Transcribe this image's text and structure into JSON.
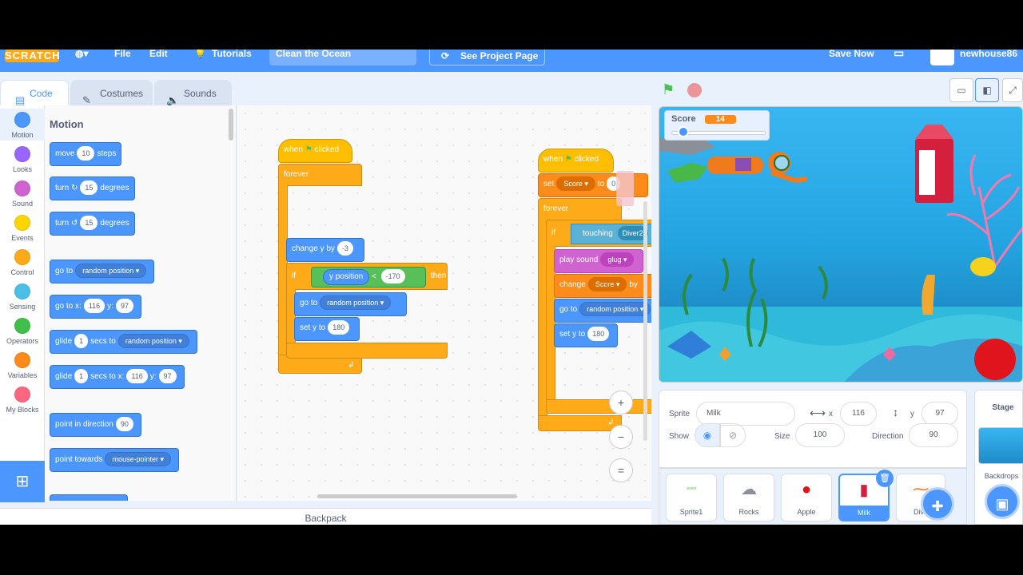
{
  "menubar": {
    "logo": "SCRATCH",
    "file": "File",
    "edit": "Edit",
    "tutorials": "Tutorials",
    "project_title": "Clean the Ocean",
    "see_project_page": "See Project Page",
    "save_now": "Save Now",
    "username": "newhouse86"
  },
  "tabs": [
    {
      "label": "Code",
      "icon": "code-icon"
    },
    {
      "label": "Costumes",
      "icon": "brush-icon"
    },
    {
      "label": "Sounds",
      "icon": "speaker-icon"
    }
  ],
  "categories": [
    {
      "label": "Motion",
      "color": "#4c97ff"
    },
    {
      "label": "Looks",
      "color": "#9966ff"
    },
    {
      "label": "Sound",
      "color": "#cf63cf"
    },
    {
      "label": "Events",
      "color": "#ffd500"
    },
    {
      "label": "Control",
      "color": "#ffab19"
    },
    {
      "label": "Sensing",
      "color": "#4cbfe6"
    },
    {
      "label": "Operators",
      "color": "#40bf4a"
    },
    {
      "label": "Variables",
      "color": "#ff8c1a"
    },
    {
      "label": "My Blocks",
      "color": "#ff6680"
    }
  ],
  "palette": {
    "title": "Motion",
    "move": {
      "a": "move",
      "v": "10",
      "b": "steps"
    },
    "turn_cw": {
      "a": "turn",
      "v": "15",
      "b": "degrees"
    },
    "turn_ccw": {
      "a": "turn",
      "v": "15",
      "b": "degrees"
    },
    "goto": {
      "a": "go to",
      "dd": "random position"
    },
    "gotoxy": {
      "a": "go to x:",
      "x": "116",
      "b": "y:",
      "y": "97"
    },
    "glide": {
      "a": "glide",
      "v": "1",
      "b": "secs to",
      "dd": "random position"
    },
    "glidexy": {
      "a": "glide",
      "v": "1",
      "b": "secs to x:",
      "x": "116",
      "c": "y:",
      "y": "97"
    },
    "point_dir": {
      "a": "point in direction",
      "v": "90"
    },
    "point_towards": {
      "a": "point towards",
      "dd": "mouse-pointer"
    }
  },
  "script1": {
    "when": "when",
    "clicked": "clicked",
    "forever": "forever",
    "change_y": "change y by",
    "change_y_val": "-3",
    "if": "if",
    "then": "then",
    "ypos": "y position",
    "lt": "<",
    "ypos_val": "-170",
    "goto": "go to",
    "goto_dd": "random position",
    "sety": "set y to",
    "sety_val": "180"
  },
  "script2": {
    "when": "when",
    "clicked": "clicked",
    "set": "set",
    "set_var": "Score",
    "to": "to",
    "set_val": "0",
    "forever": "forever",
    "if": "if",
    "touching": "touching",
    "touching_dd": "Diver2",
    "play_sound": "play sound",
    "sound_dd": "glug",
    "change": "change",
    "change_var": "Score",
    "by": "by",
    "goto": "go to",
    "goto_dd": "random position",
    "sety": "set y to",
    "sety_val": "180"
  },
  "zoom": {
    "in": "+",
    "out": "−",
    "reset": "="
  },
  "backpack": "Backpack",
  "stage_monitor": {
    "label": "Score",
    "value": "14",
    "slider_fraction": 0.1
  },
  "sprite_info": {
    "sprite_label": "Sprite",
    "sprite_name": "Milk",
    "x_label": "x",
    "x": "116",
    "y_label": "y",
    "y": "97",
    "show_label": "Show",
    "size_label": "Size",
    "size": "100",
    "direction_label": "Direction",
    "direction": "90"
  },
  "sprites": [
    {
      "name": "Sprite1",
      "icon": "text-thumb"
    },
    {
      "name": "Rocks",
      "icon": "rock-icon"
    },
    {
      "name": "Apple",
      "icon": "apple-icon"
    },
    {
      "name": "Milk",
      "icon": "milk-carton-icon"
    },
    {
      "name": "Dive",
      "icon": "diver-icon"
    }
  ],
  "stage_target": {
    "label": "Stage",
    "backdrops": "Backdrops"
  }
}
